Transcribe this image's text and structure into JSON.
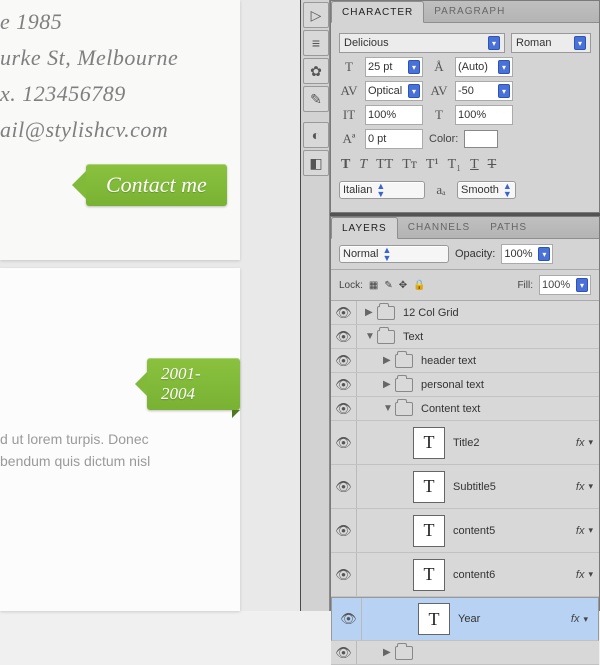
{
  "doc": {
    "line1": "e 1985",
    "line2": "urke St, Melbourne",
    "line3": "x. 123456789",
    "line4": "ail@stylishcv.com",
    "contact_label": "Contact me",
    "year_tag": "2001-2004",
    "body1": "d ut lorem turpis. Donec",
    "body2": "bendum quis dictum nisl"
  },
  "char_panel": {
    "tabs": [
      "CHARACTER",
      "PARAGRAPH"
    ],
    "font_family": "Delicious",
    "font_style": "Roman",
    "size": "25 pt",
    "leading": "(Auto)",
    "kerning_mode": "Optical",
    "tracking": "-50",
    "hscale": "100%",
    "vscale": "100%",
    "baseline": "0 pt",
    "color_label": "Color:",
    "lang": "Italian",
    "aa": "Smooth"
  },
  "layers_panel": {
    "tabs": [
      "LAYERS",
      "CHANNELS",
      "PATHS"
    ],
    "mode": "Normal",
    "opacity_label": "Opacity:",
    "opacity": "100%",
    "lock_label": "Lock:",
    "fill_label": "Fill:",
    "fill": "100%",
    "layers": [
      {
        "type": "group",
        "name": "12 Col Grid",
        "indent": 0,
        "open": false
      },
      {
        "type": "group",
        "name": "Text",
        "indent": 0,
        "open": true
      },
      {
        "type": "group",
        "name": "header text",
        "indent": 1,
        "open": false
      },
      {
        "type": "group",
        "name": "personal text",
        "indent": 1,
        "open": false
      },
      {
        "type": "group",
        "name": "Content text",
        "indent": 1,
        "open": true
      },
      {
        "type": "text",
        "name": "Title2",
        "indent": 2,
        "fx": true
      },
      {
        "type": "text",
        "name": "Subtitle5",
        "indent": 2,
        "fx": true
      },
      {
        "type": "text",
        "name": "content5",
        "indent": 2,
        "fx": true
      },
      {
        "type": "text",
        "name": "content6",
        "indent": 2,
        "fx": true
      },
      {
        "type": "text",
        "name": "Year",
        "indent": 2,
        "fx": true,
        "selected": true
      }
    ]
  }
}
